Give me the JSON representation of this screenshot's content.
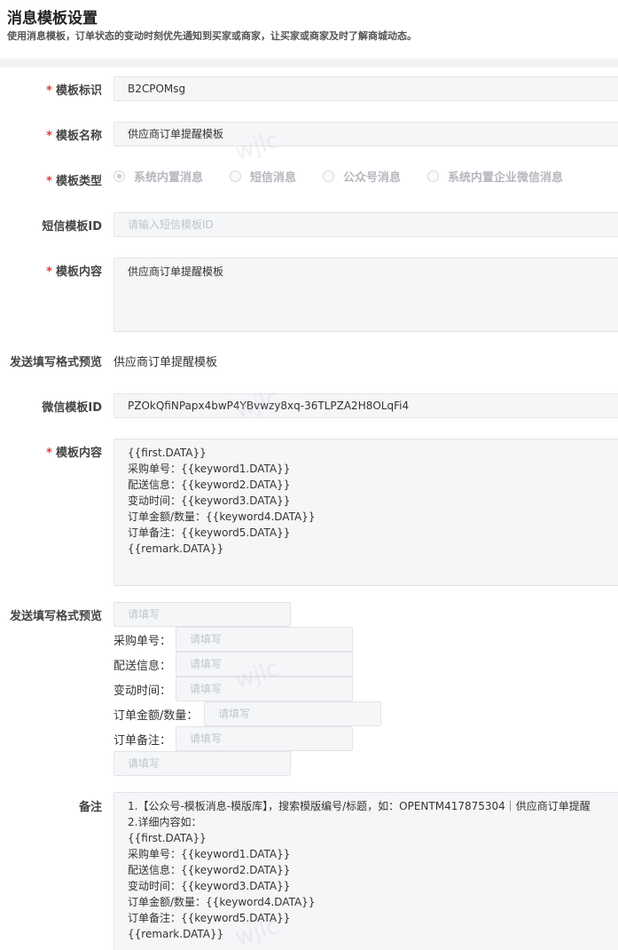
{
  "page": {
    "title": "消息模板设置",
    "description": "使用消息模板，订单状态的变动时刻优先通知到买家或商家，让买家或商家及时了解商城动态。"
  },
  "required_mark": "*",
  "form": {
    "template_id": {
      "label": "模板标识",
      "value": "B2CPOMsg"
    },
    "template_name": {
      "label": "模板名称",
      "value": "供应商订单提醒模板"
    },
    "template_type": {
      "label": "模板类型",
      "options": [
        {
          "label": "系统内置消息",
          "checked": true
        },
        {
          "label": "短信消息",
          "checked": false
        },
        {
          "label": "公众号消息",
          "checked": false
        },
        {
          "label": "系统内置企业微信消息",
          "checked": false
        }
      ]
    },
    "sms_template_id": {
      "label": "短信模板ID",
      "placeholder": "请输入短信模板ID"
    },
    "template_content": {
      "label": "模板内容",
      "value": "供应商订单提醒模板"
    },
    "send_preview_1": {
      "label": "发送填写格式预览",
      "value": "供应商订单提醒模板"
    },
    "wechat_template_id": {
      "label": "微信模板ID",
      "value": "PZOkQfiNPapx4bwP4YBvwzy8xq-36TLPZA2H8OLqFi4"
    },
    "wechat_content": {
      "label": "模板内容",
      "lines": [
        "{{first.DATA}}",
        "采购单号：{{keyword1.DATA}}",
        "配送信息：{{keyword2.DATA}}",
        "变动时间：{{keyword3.DATA}}",
        "订单金额/数量：{{keyword4.DATA}}",
        "订单备注：{{keyword5.DATA}}",
        "{{remark.DATA}}"
      ]
    },
    "send_preview_2": {
      "label": "发送填写格式预览",
      "placeholder": "请填写",
      "fields": [
        {
          "label": "采购单号："
        },
        {
          "label": "配送信息："
        },
        {
          "label": "变动时间："
        },
        {
          "label": "订单金额/数量："
        },
        {
          "label": "订单备注："
        }
      ]
    },
    "remark": {
      "label": "备注",
      "lines": [
        "1.【公众号-模板消息-模版库】，搜索模版编号/标题，如：OPENTM417875304｜供应商订单提醒",
        "2.详细内容如：",
        "{{first.DATA}}",
        "采购单号：{{keyword1.DATA}}",
        "配送信息：{{keyword2.DATA}}",
        "变动时间：{{keyword3.DATA}}",
        "订单金额/数量：{{keyword4.DATA}}",
        "订单备注：{{keyword5.DATA}}",
        "{{remark.DATA}}"
      ]
    }
  },
  "watermark_text": "wjlc",
  "colors": {
    "required": "#e4393c",
    "input_bg": "#f5f6f8",
    "border": "#e2e4e8"
  }
}
